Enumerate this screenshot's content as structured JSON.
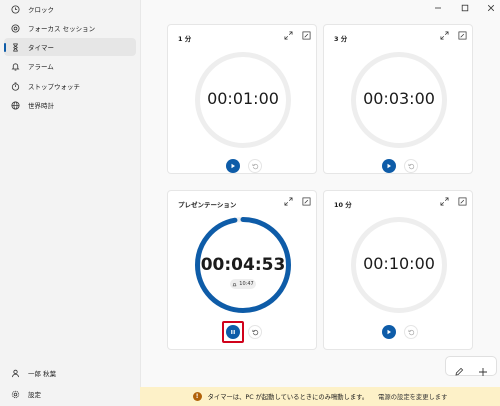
{
  "sidebar": {
    "items": [
      {
        "label": "クロック",
        "icon": "clock-icon",
        "active": false
      },
      {
        "label": "フォーカス セッション",
        "icon": "focus-icon",
        "active": false
      },
      {
        "label": "タイマー",
        "icon": "hourglass-icon",
        "active": true
      },
      {
        "label": "アラーム",
        "icon": "bell-icon",
        "active": false
      },
      {
        "label": "ストップウォッチ",
        "icon": "stopwatch-icon",
        "active": false
      },
      {
        "label": "世界時計",
        "icon": "globe-icon",
        "active": false
      }
    ],
    "user": {
      "label": "一郎 秋葉",
      "icon": "person-icon"
    },
    "settings": {
      "label": "設定",
      "icon": "gear-icon"
    }
  },
  "timers": [
    {
      "name": "1 分",
      "time": "00:01:00",
      "state": "stopped"
    },
    {
      "name": "3 分",
      "time": "00:03:00",
      "state": "stopped"
    },
    {
      "name": "プレゼンテーション",
      "time": "00:04:53",
      "state": "running",
      "end_time": "10:47",
      "progress_remaining": 0.97
    },
    {
      "name": "10 分",
      "time": "00:10:00",
      "state": "stopped"
    }
  ],
  "banner": {
    "message": "タイマーは、PC が起動しているときにのみ鳴動します。",
    "link": "電源の設定を変更します"
  },
  "colors": {
    "accent": "#0e5ca8",
    "highlight": "#d0021b",
    "banner_bg": "#fdf1c8",
    "ring_track": "#eeeeee"
  }
}
